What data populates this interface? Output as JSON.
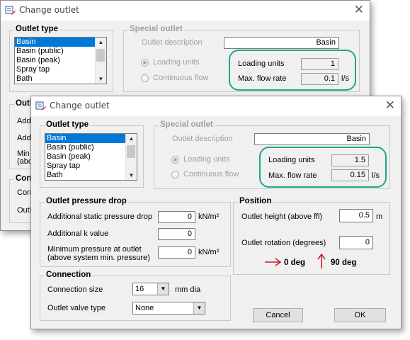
{
  "back_window": {
    "title": "Change outlet",
    "outlet_type_label": "Outlet type",
    "outlet_types": [
      "Basin",
      "Basin (public)",
      "Basin (peak)",
      "Spray tap",
      "Bath"
    ],
    "special_outlet_label": "Special outlet",
    "outlet_description_label": "Outlet description",
    "outlet_description_value": "Basin",
    "loading_units_radio": "Loading units",
    "continuous_flow_radio": "Continuous flow",
    "loading_units_label": "Loading units",
    "loading_units_value": "1",
    "max_flow_label": "Max. flow rate",
    "max_flow_value": "0.1",
    "max_flow_unit": "l/s",
    "partial_outl": "Outl",
    "partial_addi": "Addi",
    "partial_add": "Add",
    "partial_min": "Min",
    "partial_abo": "(abo",
    "partial_conn_group": "Conr",
    "partial_conn": "Conn",
    "partial_outl2": "Outl"
  },
  "front_window": {
    "title": "Change outlet",
    "outlet_type_label": "Outlet type",
    "outlet_types": [
      "Basin",
      "Basin (public)",
      "Basin (peak)",
      "Spray tap",
      "Bath"
    ],
    "special_outlet_label": "Special outlet",
    "outlet_description_label": "Outlet description",
    "outlet_description_value": "Basin",
    "loading_units_radio": "Loading units",
    "continuous_flow_radio": "Continuous flow",
    "loading_units_label": "Loading units",
    "loading_units_value": "1.5",
    "max_flow_label": "Max. flow rate",
    "max_flow_value": "0.15",
    "max_flow_unit": "l/s",
    "pressure_drop": {
      "label": "Outlet pressure drop",
      "static_label": "Additional static pressure drop",
      "static_value": "0",
      "static_unit": "kN/m²",
      "k_label": "Additional k value",
      "k_value": "0",
      "min_pressure_label_1": "Minimum pressure at outlet",
      "min_pressure_label_2": "(above system min. pressure)",
      "min_pressure_value": "0",
      "min_pressure_unit": "kN/m²"
    },
    "position": {
      "label": "Position",
      "height_label": "Outlet height (above ffl)",
      "height_value": "0.5",
      "height_unit": "m",
      "rotation_label": "Outlet rotation (degrees)",
      "rotation_value": "0",
      "annotation_0": "0 deg",
      "annotation_90": "90 deg"
    },
    "connection": {
      "label": "Connection",
      "size_label": "Connection size",
      "size_value": "16",
      "size_unit": "mm dia",
      "valve_label": "Outlet valve type",
      "valve_value": "None"
    },
    "cancel_label": "Cancel",
    "ok_label": "OK"
  },
  "colors": {
    "highlight": "#1fa68f",
    "arrow": "#c0202a",
    "selection": "#0078d7"
  }
}
